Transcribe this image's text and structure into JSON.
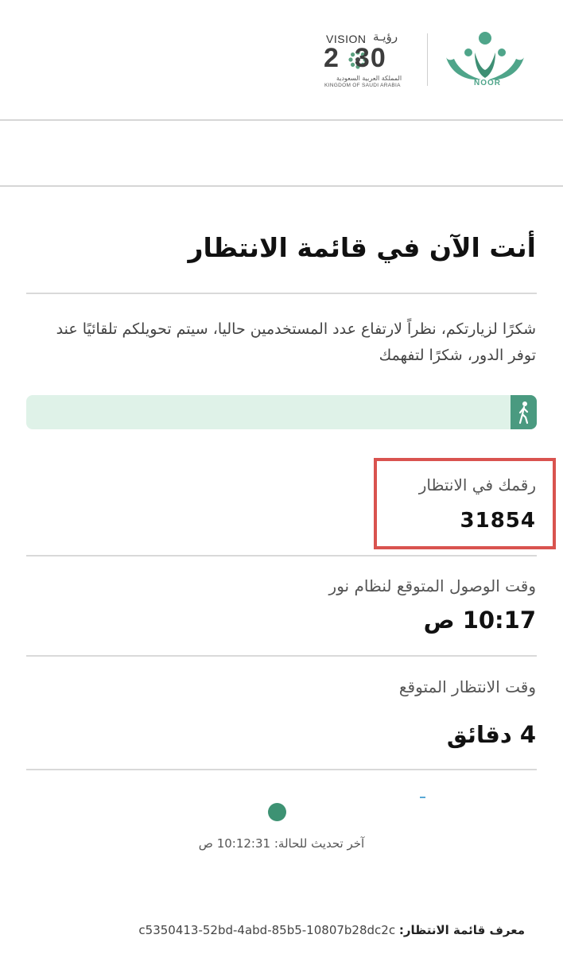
{
  "header": {
    "logo_name": "NOOR",
    "vision": {
      "word_en": "VISION",
      "word_ar": "رؤيـة",
      "year": "2030",
      "country_ar": "المملكة العربية السعودية",
      "country_en": "KINGDOM OF SAUDI ARABIA"
    }
  },
  "main": {
    "title": "أنت الآن في قائمة الانتظار",
    "description": "شكرًا لزيارتكم، نظراً لارتفاع عدد المستخدمين حاليا، سيتم تحويلكم تلقائيًا عند توفر الدور، شكرًا لتفهمك",
    "progress": {
      "fraction": 0.02,
      "icon": "walking-person-icon"
    },
    "queue_number": {
      "label": "رقمك في الانتظار",
      "value": "31854"
    },
    "arrival_time": {
      "label": "وقت الوصول المتوقع لنظام نور",
      "value": "10:17 ص"
    },
    "wait_time": {
      "label": "وقت الانتظار المتوقع",
      "value": "4 دقائق"
    },
    "last_update": {
      "label": "آخر تحديث للحالة:",
      "value": "10:12:31 ص"
    },
    "queue_id": {
      "label": "معرف قائمة الانتظار:",
      "value": "c5350413-52bd-4abd-85b5-10807b28dc2c"
    }
  },
  "colors": {
    "brand_green": "#4a9a80",
    "progress_bg": "#dff2e8",
    "highlight_border": "#d9534f",
    "status_dot": "#3d9273"
  }
}
